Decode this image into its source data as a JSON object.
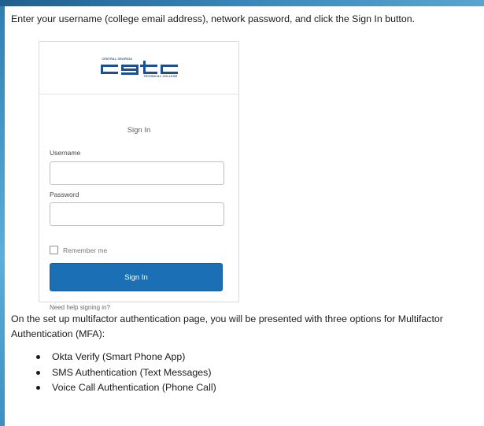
{
  "intro_text": "Enter your username (college email address), network password, and click the Sign In button.",
  "login_card": {
    "logo": {
      "top_text": "CENTRAL GEORGIA",
      "bottom_text": "TECHNICAL COLLEGE",
      "mark_text": "cgtc",
      "color": "#1c4f94"
    },
    "title": "Sign In",
    "username_label": "Username",
    "username_value": "",
    "password_label": "Password",
    "password_value": "",
    "remember_label": "Remember me",
    "remember_checked": false,
    "signin_label": "Sign In",
    "help_link": "Need help signing in?",
    "accent_color": "#1b6fb5"
  },
  "mfa_paragraph": "On the set up multifactor authentication page, you will be presented with three options for Multifactor Authentication (MFA):",
  "mfa_options": [
    "Okta Verify (Smart Phone App)",
    "SMS Authentication (Text Messages)",
    "Voice Call Authentication (Phone Call)"
  ]
}
